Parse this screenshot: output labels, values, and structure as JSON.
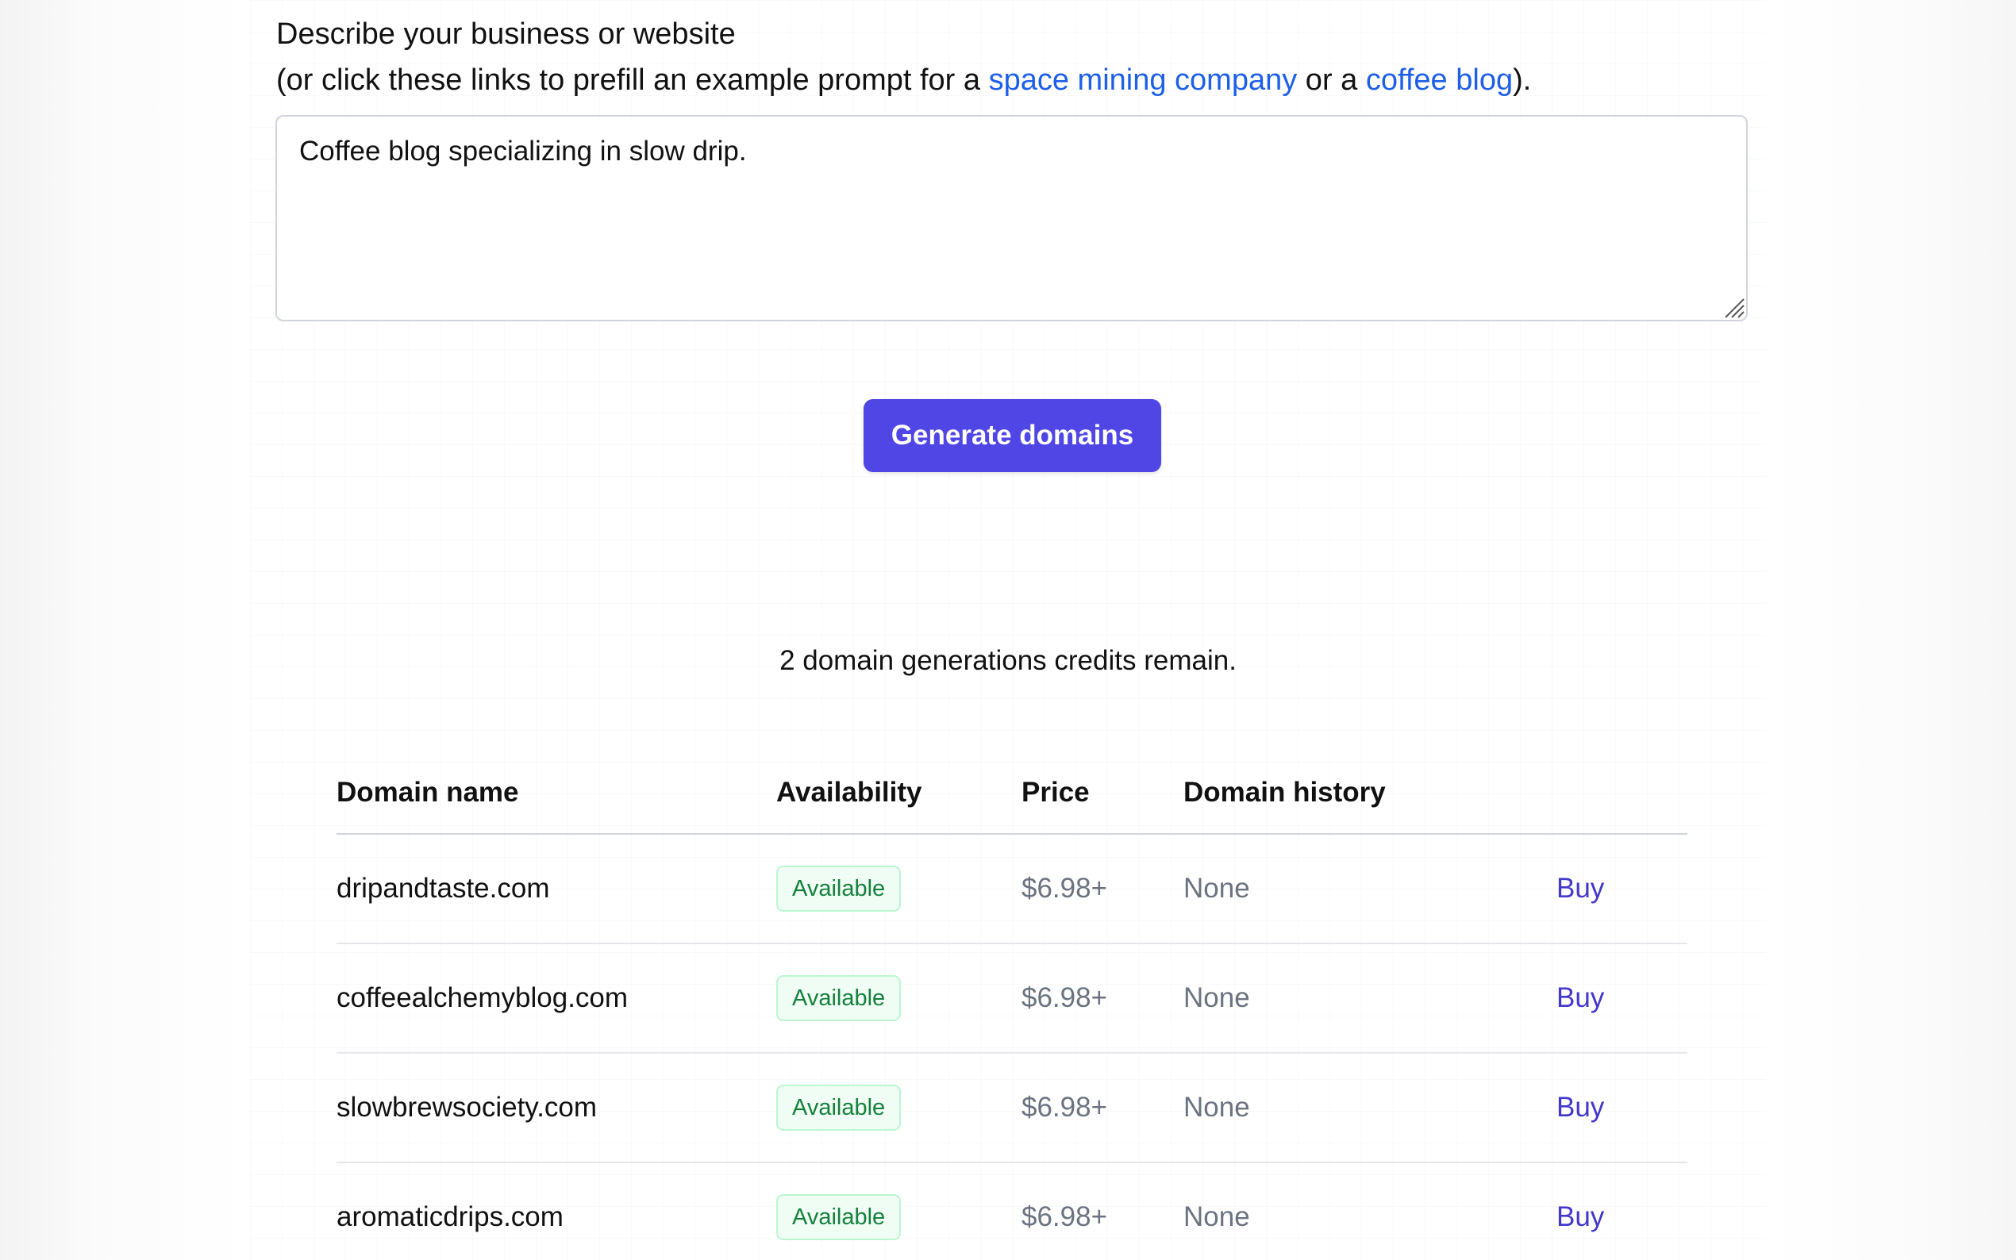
{
  "prompt": {
    "label_line1": "Describe your business or website",
    "label_line2_prefix": "(or click these links to prefill an example prompt for a ",
    "link_space": "space mining company",
    "label_middle": " or a ",
    "link_coffee": "coffee blog",
    "label_suffix": ").",
    "value": "Coffee blog specializing in slow drip."
  },
  "generate_button": {
    "label": "Generate domains",
    "color": "#4f46e5"
  },
  "credits_text": "2 domain generations credits remain.",
  "table": {
    "headers": {
      "domain_name": "Domain name",
      "availability": "Availability",
      "price": "Price",
      "history": "Domain history"
    },
    "rows": [
      {
        "domain": "dripandtaste.com",
        "availability": "Available",
        "price": "$6.98+",
        "history": "None",
        "action": "Buy"
      },
      {
        "domain": "coffeealchemyblog.com",
        "availability": "Available",
        "price": "$6.98+",
        "history": "None",
        "action": "Buy"
      },
      {
        "domain": "slowbrewsociety.com",
        "availability": "Available",
        "price": "$6.98+",
        "history": "None",
        "action": "Buy"
      },
      {
        "domain": "aromaticdrips.com",
        "availability": "Available",
        "price": "$6.98+",
        "history": "None",
        "action": "Buy"
      }
    ]
  },
  "colors": {
    "link": "#1d5fe8",
    "badge_text": "#15803d",
    "badge_bg": "#f0fdf4",
    "buy_link": "#4338ca"
  }
}
